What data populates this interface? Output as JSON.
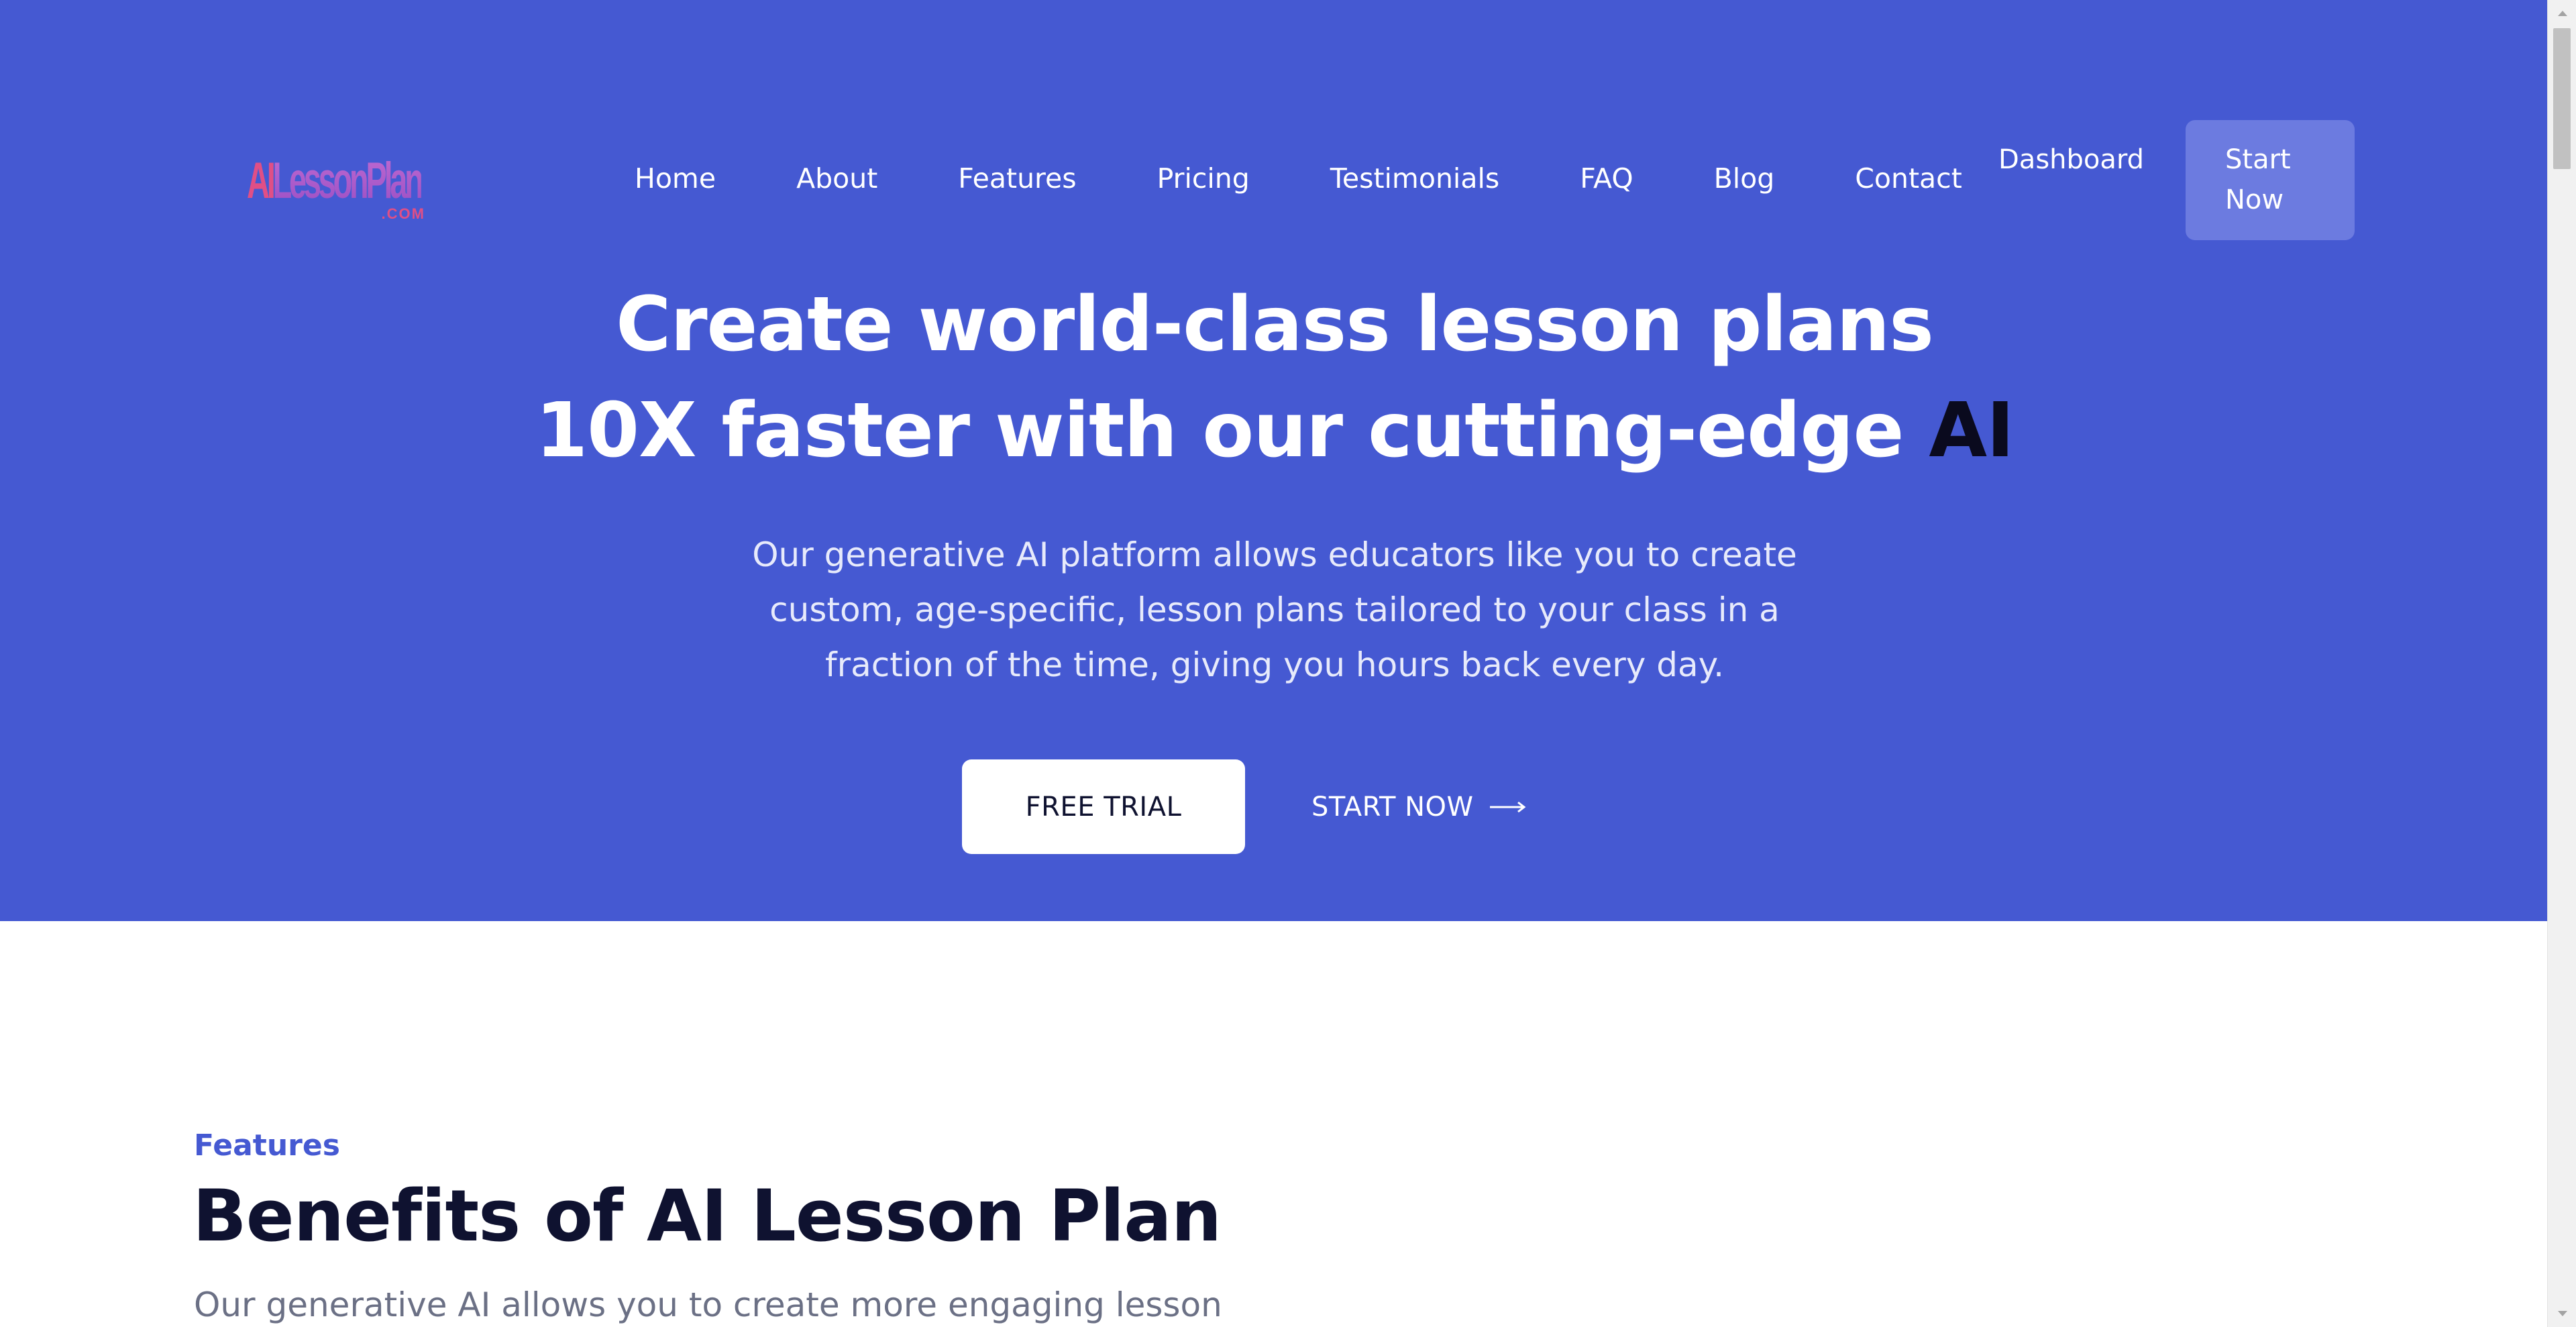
{
  "brand": {
    "logo_text_ai": "AI",
    "logo_text_rest": "LessonPlan",
    "logo_suffix": ".COM"
  },
  "nav": {
    "links": [
      "Home",
      "About",
      "Features",
      "Pricing",
      "Testimonials",
      "FAQ",
      "Blog",
      "Contact"
    ],
    "dashboard": "Dashboard",
    "start_now": "Start\nNow"
  },
  "hero": {
    "headline_line1": "Create world-class lesson plans",
    "headline_line2": "10X faster with our cutting-edge",
    "headline_highlight": "AI",
    "subtext": "Our generative AI platform allows educators like you to create custom, age-specific, lesson plans tailored to your class in a fraction of the time, giving you hours back every day.",
    "free_trial": "FREE TRIAL",
    "start_now": "START NOW"
  },
  "features": {
    "eyebrow": "Features",
    "title": "Benefits of AI Lesson Plan",
    "description": "Our generative AI allows you to create more engaging lesson"
  },
  "colors": {
    "hero_bg": "#4559d2",
    "start_btn_bg": "#6c7be0",
    "accent": "#4559d2",
    "heading_dark": "#0f1230"
  },
  "icons": {
    "cta_arrow": "long-arrow-right-icon",
    "scroll_up": "triangle-up-icon",
    "scroll_down": "triangle-down-icon"
  }
}
